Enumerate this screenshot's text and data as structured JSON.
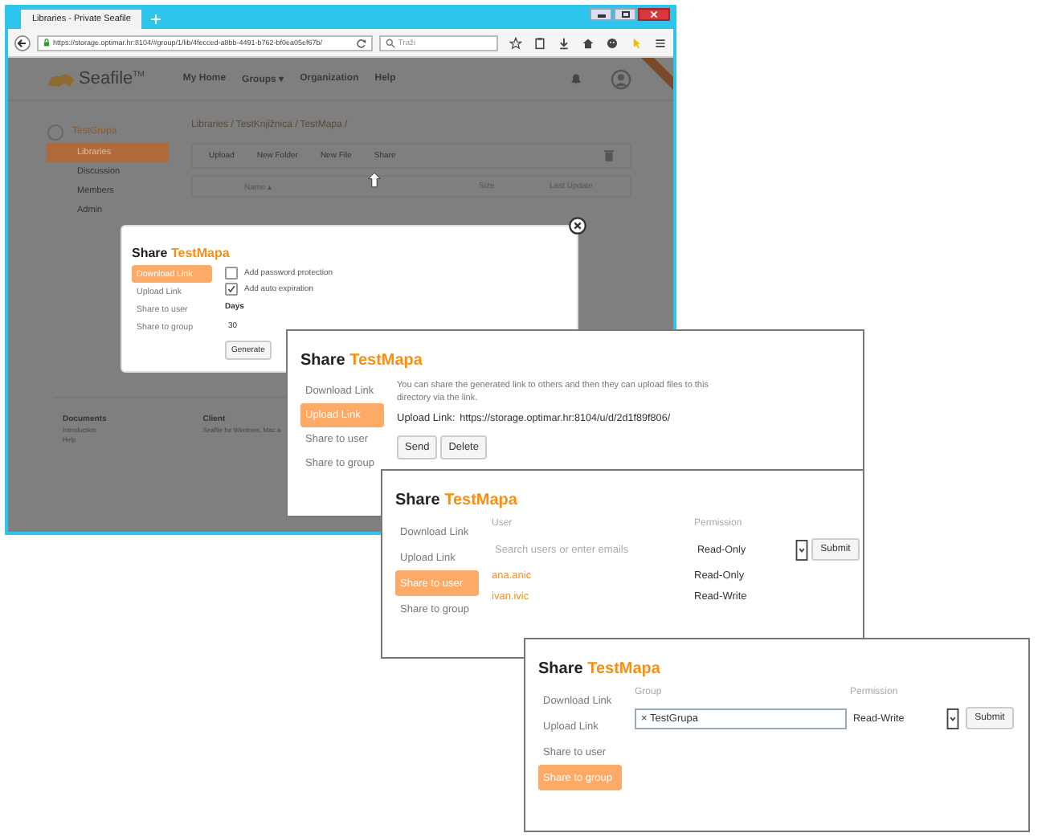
{
  "browser": {
    "tab_title": "Libraries - Private Seafile",
    "url": "https://storage.optimar.hr:8104/#group/1/lib/4fecced-a8bb-4491-b762-bf0ea05ef67b/",
    "search_placeholder": "Traži"
  },
  "seafile": {
    "logo": "Seafile$^{TM}$",
    "nav": [
      "My Home",
      "Groups ▾",
      "Organization",
      "Help"
    ],
    "group": "TestGrupa",
    "sidebar": [
      {
        "label": "Libraries",
        "selected": true
      },
      {
        "label": "Discussion",
        "selected": false
      },
      {
        "label": "Members",
        "selected": false
      },
      {
        "label": "Admin",
        "selected": false
      }
    ],
    "breadcrumb": "Libraries / TestKnjižnica / TestMapa /",
    "toolbar": [
      "Upload",
      "New Folder",
      "New File",
      "Share"
    ],
    "columns": [
      "Name ▴",
      "Size",
      "Last Update"
    ],
    "footer": [
      {
        "title": "Documents",
        "lines": [
          "Introduction",
          "Help"
        ]
      },
      {
        "title": "Client",
        "lines": [
          "Seafile for Windows, Mac a"
        ]
      }
    ]
  },
  "dialogs": [
    {
      "kind": "download",
      "title": "Share",
      "name": "TestMapa",
      "close": true,
      "tabs": [
        {
          "label": "Download Link",
          "selected": true
        },
        {
          "label": "Upload Link",
          "selected": false
        },
        {
          "label": "Share to user",
          "selected": false
        },
        {
          "label": "Share to group",
          "selected": false
        }
      ],
      "options": [
        {
          "label": "Add password protection",
          "checked": false
        },
        {
          "label": "Add auto expiration",
          "checked": true
        }
      ],
      "days_label": "Days",
      "days_value": "30",
      "button": "Generate"
    },
    {
      "kind": "upload",
      "title": "Share",
      "name": "TestMapa",
      "close": false,
      "tabs": [
        {
          "label": "Download Link",
          "selected": false
        },
        {
          "label": "Upload Link",
          "selected": true
        },
        {
          "label": "Share to user",
          "selected": false
        },
        {
          "label": "Share to group",
          "selected": false
        }
      ],
      "description": "You can share the generated link to others and then they can upload files to this directory via the link.",
      "link_label": "Upload Link:",
      "link": "https://storage.optimar.hr:8104/u/d/2d1f89f806/",
      "buttons": [
        "Send",
        "Delete"
      ]
    },
    {
      "kind": "user",
      "title": "Share",
      "name": "TestMapa",
      "close": false,
      "tabs": [
        {
          "label": "Download Link",
          "selected": false
        },
        {
          "label": "Upload Link",
          "selected": false
        },
        {
          "label": "Share to user",
          "selected": true
        },
        {
          "label": "Share to group",
          "selected": false
        }
      ],
      "headers": [
        "User",
        "Permission"
      ],
      "placeholder": "Search users or enter emails",
      "permission": "Read-Only",
      "submit": "Submit",
      "rows": [
        {
          "user": "ana.anic",
          "permission": "Read-Only"
        },
        {
          "user": "ivan.ivic",
          "permission": "Read-Write"
        }
      ]
    },
    {
      "kind": "group",
      "title": "Share",
      "name": "TestMapa",
      "close": false,
      "tabs": [
        {
          "label": "Download Link",
          "selected": false
        },
        {
          "label": "Upload Link",
          "selected": false
        },
        {
          "label": "Share to user",
          "selected": false
        },
        {
          "label": "Share to group",
          "selected": true
        }
      ],
      "headers": [
        "Group",
        "Permission"
      ],
      "tag_remove": "×",
      "tag": "TestGrupa",
      "permission": "Read-Write",
      "submit": "Submit"
    }
  ]
}
